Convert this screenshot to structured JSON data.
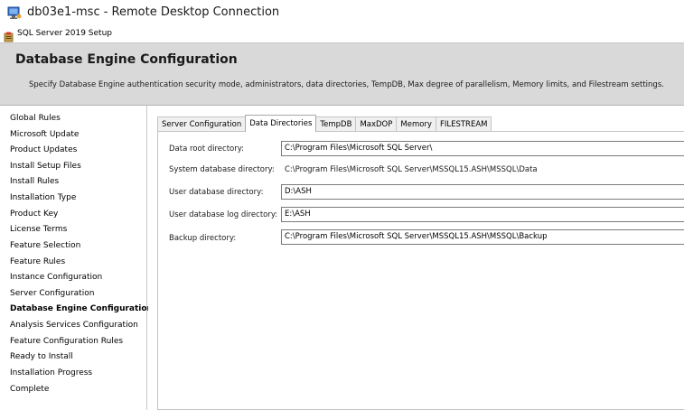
{
  "window": {
    "title": "db03e1-msc - Remote Desktop Connection",
    "setup_title": "SQL Server 2019 Setup",
    "icons": [
      "remote-desktop-icon",
      "sql-setup-icon"
    ]
  },
  "header": {
    "title": "Database Engine Configuration",
    "description": "Specify Database Engine authentication security mode, administrators, data directories, TempDB, Max degree of parallelism, Memory limits, and Filestream settings."
  },
  "sidebar": {
    "items": [
      {
        "label": "Global Rules"
      },
      {
        "label": "Microsoft Update"
      },
      {
        "label": "Product Updates"
      },
      {
        "label": "Install Setup Files"
      },
      {
        "label": "Install Rules"
      },
      {
        "label": "Installation Type"
      },
      {
        "label": "Product Key"
      },
      {
        "label": "License Terms"
      },
      {
        "label": "Feature Selection"
      },
      {
        "label": "Feature Rules"
      },
      {
        "label": "Instance Configuration"
      },
      {
        "label": "Server Configuration"
      },
      {
        "label": "Database Engine Configuration"
      },
      {
        "label": "Analysis Services Configuration"
      },
      {
        "label": "Feature Configuration Rules"
      },
      {
        "label": "Ready to Install"
      },
      {
        "label": "Installation Progress"
      },
      {
        "label": "Complete"
      }
    ],
    "active": "Database Engine Configuration"
  },
  "tabs": [
    {
      "label": "Server Configuration"
    },
    {
      "label": "Data Directories"
    },
    {
      "label": "TempDB"
    },
    {
      "label": "MaxDOP"
    },
    {
      "label": "Memory"
    },
    {
      "label": "FILESTREAM"
    }
  ],
  "active_tab": "Data Directories",
  "data_directories": {
    "data_root": {
      "label": "Data root directory:",
      "value": "C:\\Program Files\\Microsoft SQL Server\\"
    },
    "system_db": {
      "label": "System database directory:",
      "value": "C:\\Program Files\\Microsoft SQL Server\\MSSQL15.ASH\\MSSQL\\Data"
    },
    "user_db": {
      "label": "User database directory:",
      "value": "D:\\ASH"
    },
    "user_db_log": {
      "label": "User database log directory:",
      "value": "E:\\ASH"
    },
    "backup": {
      "label": "Backup directory:",
      "value": "C:\\Program Files\\Microsoft SQL Server\\MSSQL15.ASH\\MSSQL\\Backup"
    }
  },
  "colors": {
    "header_bg": "#d9d9d9",
    "window_bg": "#ffffff"
  }
}
